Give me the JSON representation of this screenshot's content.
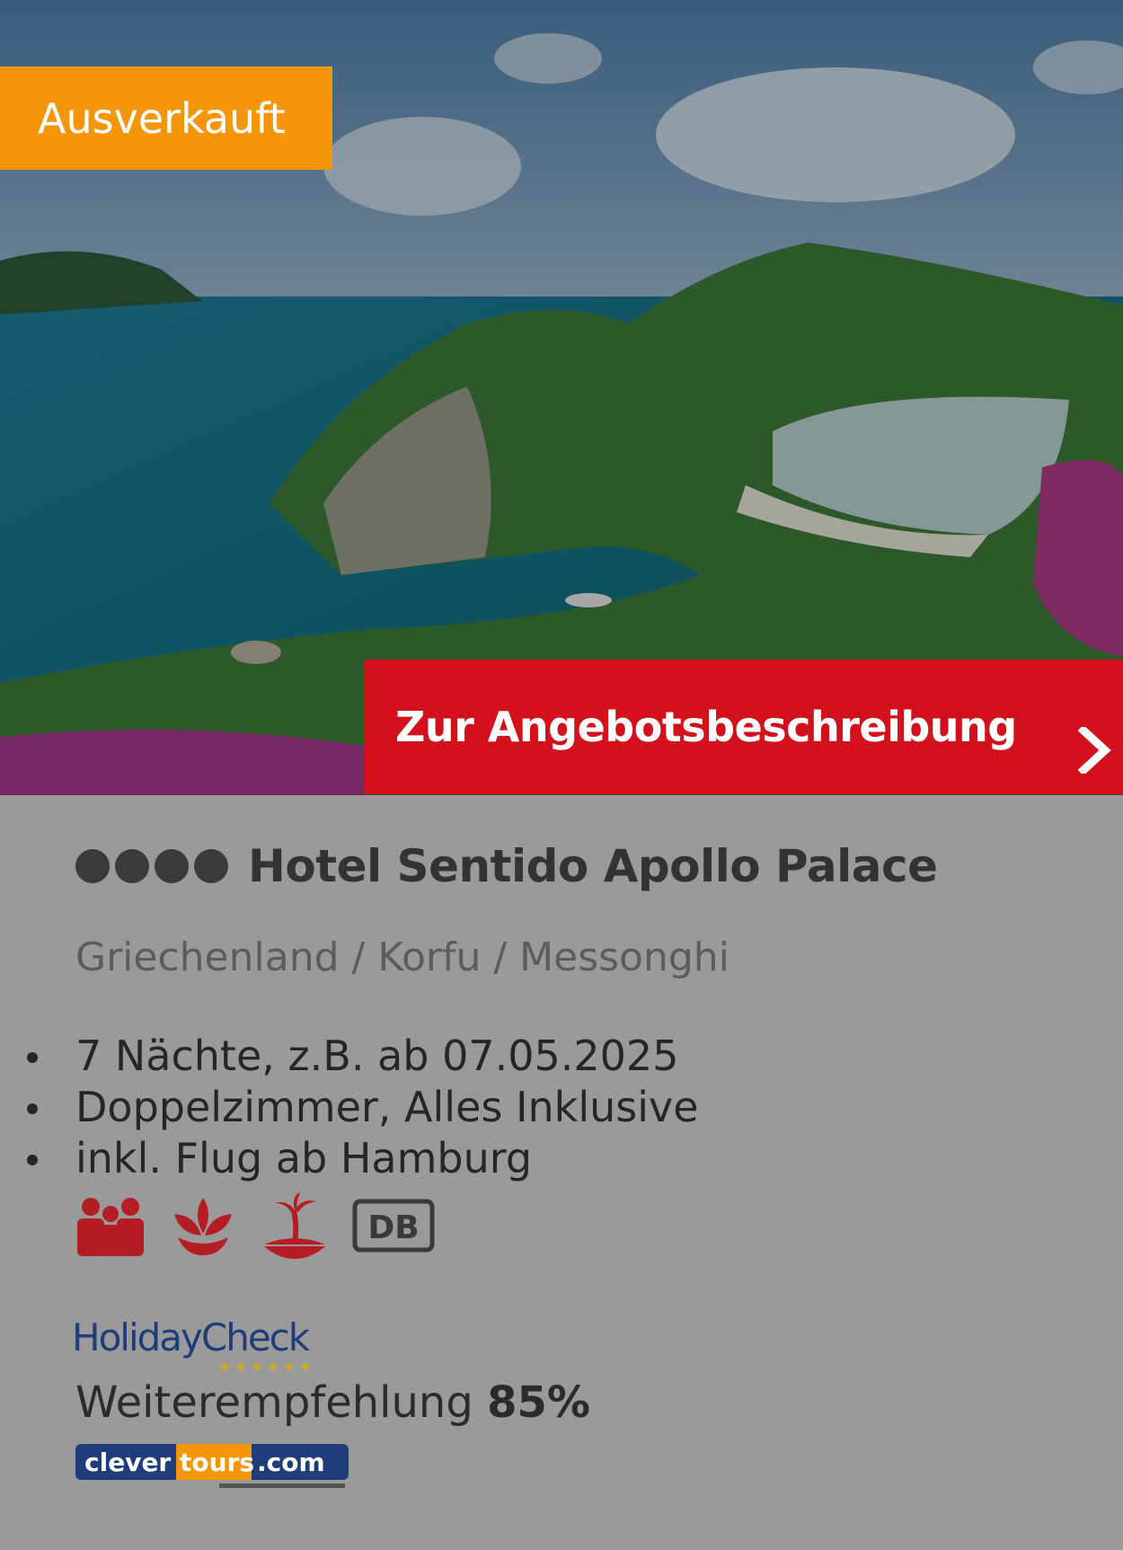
{
  "badge": {
    "label": "Ausverkauft"
  },
  "cta": {
    "label": "Zur Angebotsbeschreibung",
    "icon": "chevron-right-icon"
  },
  "hotel": {
    "stars": 4,
    "name": "Hotel Sentido Apollo Palace",
    "location": "Griechenland / Korfu / Messonghi"
  },
  "features": [
    "7 Nächte, z.B. ab 07.05.2025",
    "Doppelzimmer, Alles Inklusive",
    "inkl. Flug ab Hamburg"
  ],
  "amenity_icons": [
    "family-icon",
    "spa-lotus-icon",
    "beach-island-icon",
    "db-rail-icon"
  ],
  "amenity_db_label": "DB",
  "rating": {
    "provider": "HolidayCheck",
    "label": "Weiterempfehlung",
    "value": "85%"
  },
  "operator_logo": {
    "text_left": "clever",
    "text_mid": "tours",
    "text_right": ".com"
  },
  "colors": {
    "badge": "#f5950a",
    "cta": "#d2111d",
    "content_bg": "#9a9a9a",
    "icon_red": "#b51d24"
  }
}
